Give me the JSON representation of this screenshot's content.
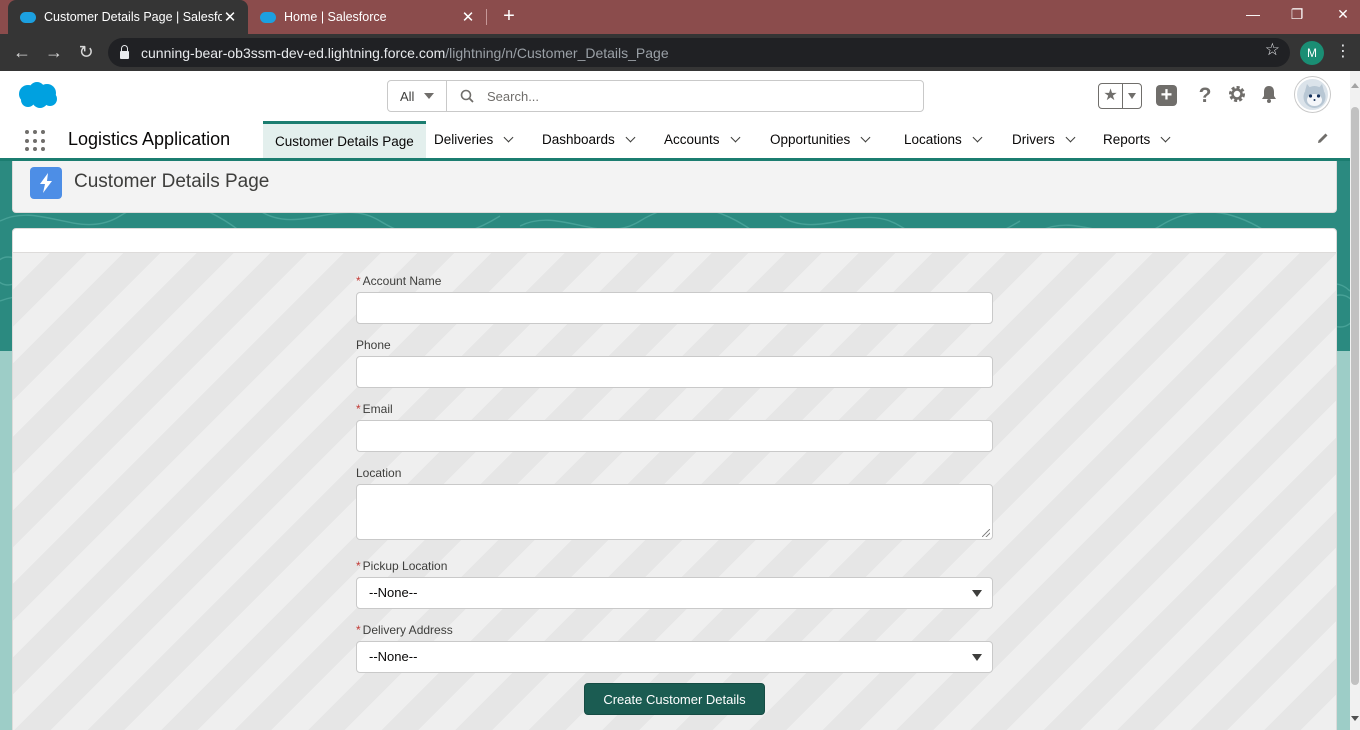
{
  "browser": {
    "tabs": [
      {
        "title": "Customer Details Page | Salesforce",
        "close": "✕"
      },
      {
        "title": "Home | Salesforce",
        "close": "✕"
      }
    ],
    "new_tab": "+",
    "window_controls": {
      "minimize": "—",
      "restore": "❐",
      "close": "✕"
    },
    "url_host": "cunning-bear-ob3ssm-dev-ed.lightning.force.com",
    "url_path": "/lightning/n/Customer_Details_Page",
    "profile_initial": "M"
  },
  "header": {
    "search_scope": "All",
    "search_placeholder": "Search..."
  },
  "appnav": {
    "app_name": "Logistics Application",
    "items": [
      {
        "label": "Customer Details Page"
      },
      {
        "label": "Deliveries"
      },
      {
        "label": "Dashboards"
      },
      {
        "label": "Accounts"
      },
      {
        "label": "Opportunities"
      },
      {
        "label": "Locations"
      },
      {
        "label": "Drivers"
      },
      {
        "label": "Reports"
      }
    ]
  },
  "page": {
    "title": "Customer Details Page"
  },
  "form": {
    "required_marker": "*",
    "account_name": {
      "label": "Account Name",
      "value": ""
    },
    "phone": {
      "label": "Phone",
      "value": ""
    },
    "email": {
      "label": "Email",
      "value": ""
    },
    "location": {
      "label": "Location",
      "value": ""
    },
    "pickup_location": {
      "label": "Pickup Location",
      "value": "--None--"
    },
    "delivery_address": {
      "label": "Delivery Address",
      "value": "--None--"
    },
    "submit_label": "Create Customer Details"
  },
  "colors": {
    "brand_teal": "#1b7d70",
    "button": "#1b5c52",
    "page_icon": "#4d8ee6",
    "chrome_tabstrip": "#8b4c4c"
  }
}
